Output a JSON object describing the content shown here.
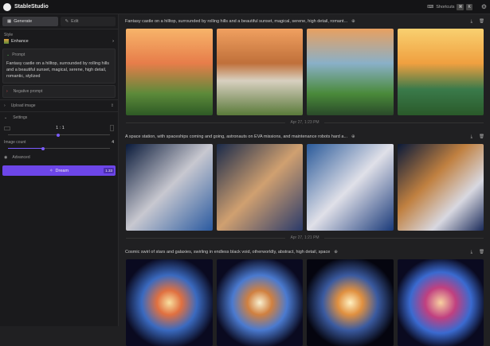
{
  "app": {
    "title": "StableStudio",
    "shortcuts_label": "Shortcuts",
    "shortcut_keys": [
      "⌘",
      "K"
    ]
  },
  "sidebar": {
    "tabs": [
      {
        "label": "Generate"
      },
      {
        "label": "Edit"
      }
    ],
    "style_label": "Style",
    "style_value": "Enhance",
    "prompt_label": "Prompt",
    "prompt_text": "Fantasy castle on a hilltop, surrounded by rolling hills and a beautiful sunset, magical, serene, high detail, romantic, stylized",
    "negative_prompt_label": "Negative prompt",
    "upload_label": "Upload image",
    "settings_label": "Settings",
    "aspect_ratio": "1 : 1",
    "image_count_label": "Image count",
    "image_count": "4",
    "advanced_label": "Advanced",
    "dream_label": "Dream",
    "dream_badge": "1.33"
  },
  "main": {
    "groups": [
      {
        "prompt": "Fantasy castle on a hilltop, surrounded by rolling hills and a beautiful sunset, magical, serene, high detail, romant...",
        "date": "Apr 27, 1:23 PM",
        "gradients": [
          "linear-gradient(#f7b46a,#e77d4a 40%,#5c8a3a 75%,#2e5a25)",
          "linear-gradient(#f0a060,#c0703a 40%,#d8d0c0 60%,#5a7a3a)",
          "linear-gradient(#e8a060,#8ab0c8 40%,#4a8a3a 75%,#2a4a2a)",
          "linear-gradient(#f8d070,#f0a040 40%,#3a7a4a 70%,#2a5a2a)"
        ]
      },
      {
        "prompt": "A space station, with spaceships coming and going, astronauts on EVA missions, and maintenance robots hard a...",
        "date": "Apr 27, 1:21 PM",
        "gradients": [
          "linear-gradient(135deg,#0a1a3a,#c8c8d0 50%,#2a5aa0)",
          "linear-gradient(135deg,#1a2a4a,#d0a070 50%,#2a3a6a)",
          "linear-gradient(135deg,#2a5a9a,#e0e0e8 50%,#1a3a7a)",
          "linear-gradient(135deg,#0a1a3a,#c08040 40%,#d8d8e0 70%,#1a2a5a)"
        ]
      },
      {
        "prompt": "Cosmic swirl of stars and galaxies, swirling in endless black void, otherworldly, abstract, high detail, space",
        "gradients": [
          "radial-gradient(circle,#f8e0a0,#e07040 20%,#3a6ac0 45%,#0a0a20 75%)",
          "radial-gradient(circle,#f8f0d0,#d08040 20%,#4a7ad0 45%,#0a0a20 75%)",
          "radial-gradient(circle,#fff0c0,#e09040 20%,#3a5aa0 45%,#05050f 75%)",
          "radial-gradient(circle,#f8d0a0,#c04080 25%,#3a6ad0 50%,#0a0a20 75%)"
        ]
      }
    ]
  }
}
